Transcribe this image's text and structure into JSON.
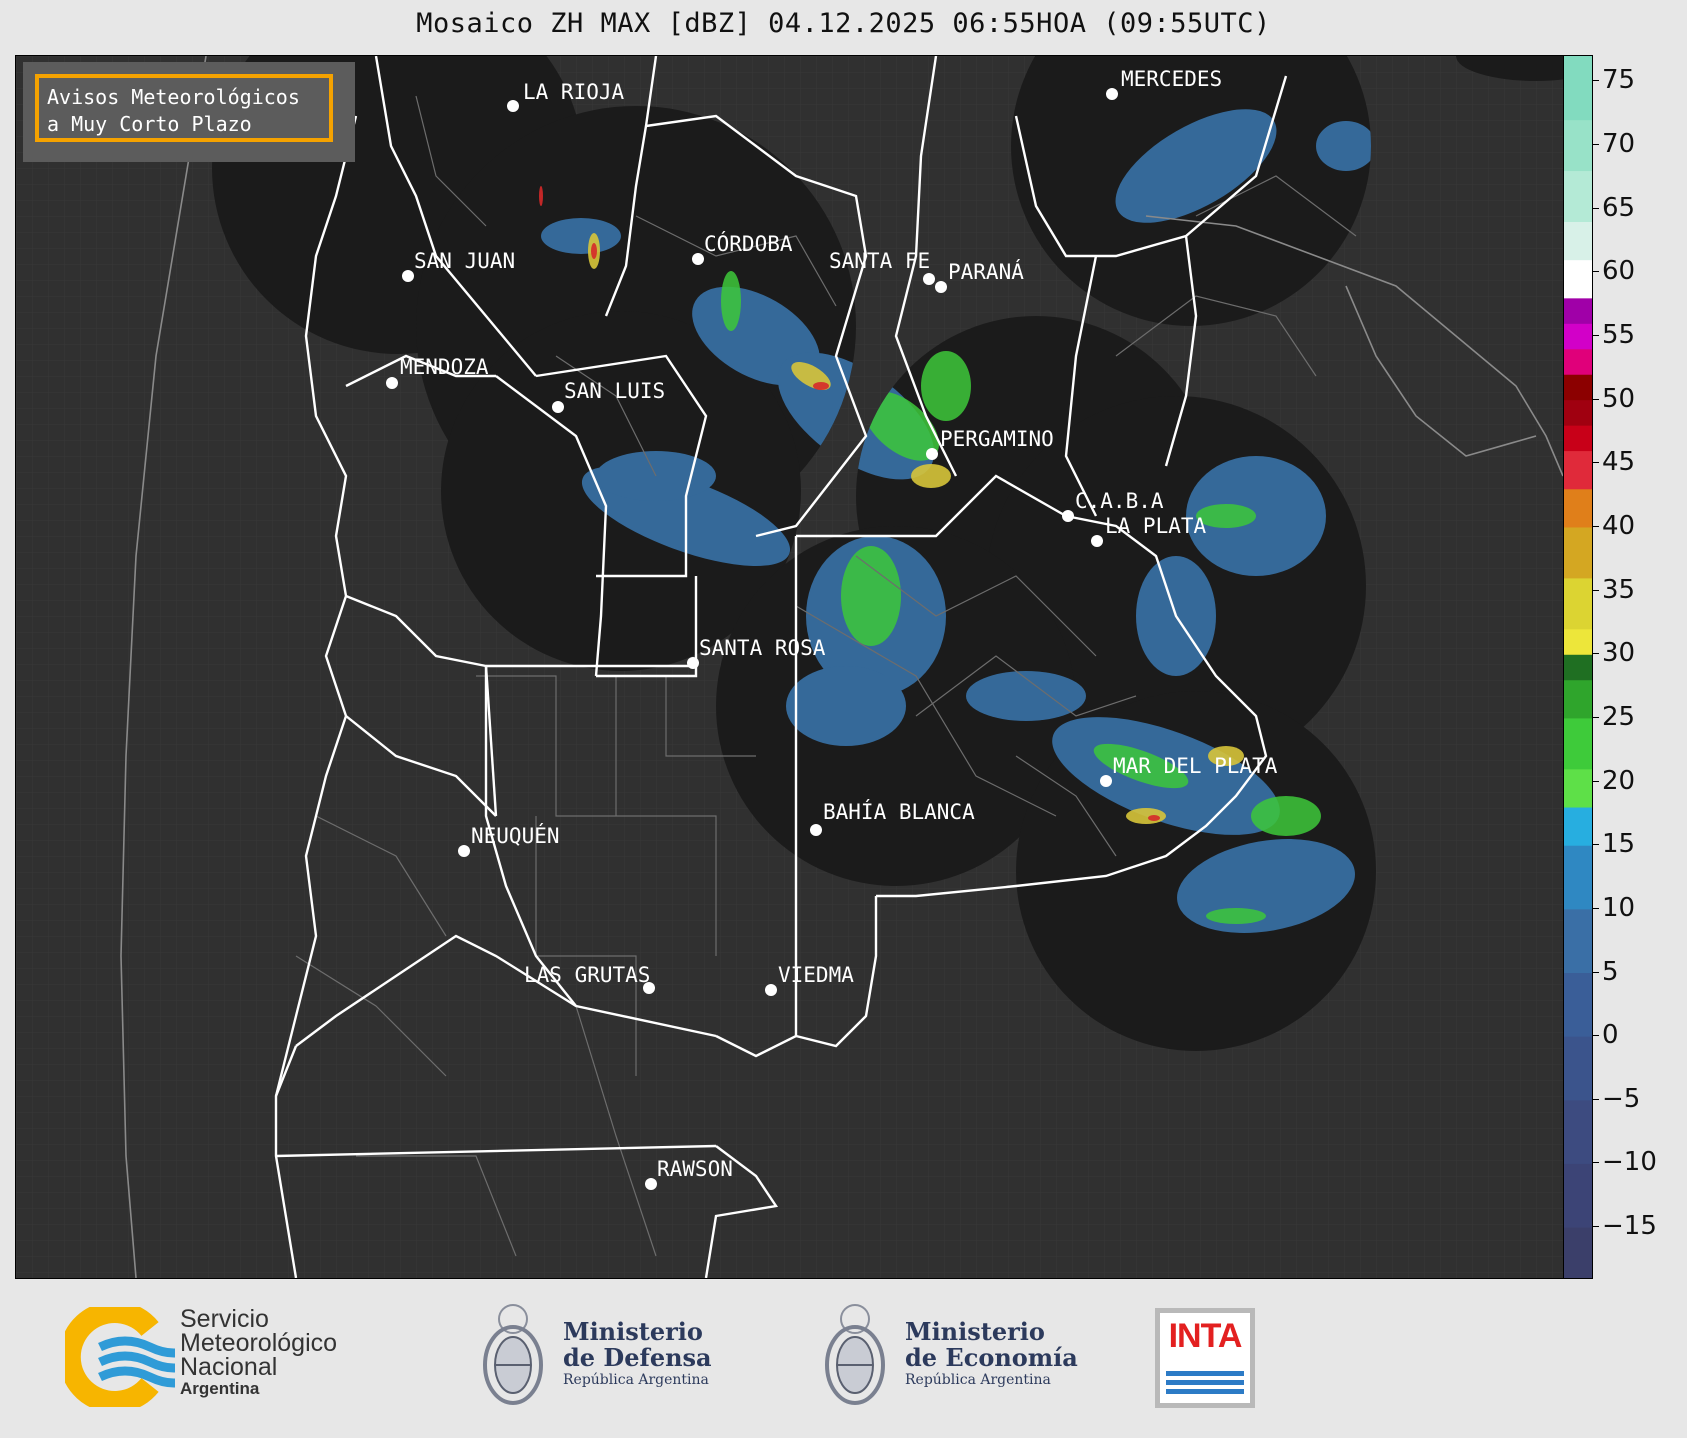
{
  "title": "Mosaico ZH MAX [dBZ] 04.12.2025 06:55HOA (09:55UTC)",
  "avisos": {
    "line1": "Avisos Meteorológicos",
    "line2": "a Muy Corto Plazo"
  },
  "cities": [
    {
      "name": "LA RIOJA",
      "key": "la-rioja"
    },
    {
      "name": "MERCEDES",
      "key": "mercedes"
    },
    {
      "name": "CÓRDOBA",
      "key": "cordoba"
    },
    {
      "name": "SAN JUAN",
      "key": "san-juan"
    },
    {
      "name": "SANTA FE",
      "key": "santa-fe"
    },
    {
      "name": "PARANÁ",
      "key": "parana"
    },
    {
      "name": "MENDOZA",
      "key": "mendoza"
    },
    {
      "name": "SAN LUIS",
      "key": "san-luis"
    },
    {
      "name": "PERGAMINO",
      "key": "pergamino"
    },
    {
      "name": "C.A.B.A",
      "key": "caba"
    },
    {
      "name": "LA PLATA",
      "key": "la-plata"
    },
    {
      "name": "SANTA ROSA",
      "key": "santa-rosa"
    },
    {
      "name": "MAR DEL PLATA",
      "key": "mar-del-plata"
    },
    {
      "name": "BAHÍA BLANCA",
      "key": "bahia-blanca"
    },
    {
      "name": "NEUQUÉN",
      "key": "neuquen"
    },
    {
      "name": "LAS GRUTAS",
      "key": "las-grutas"
    },
    {
      "name": "VIEDMA",
      "key": "viedma"
    },
    {
      "name": "RAWSON",
      "key": "rawson"
    }
  ],
  "colorbar": {
    "min": -19,
    "max": 77,
    "ticks": [
      "75",
      "70",
      "65",
      "60",
      "55",
      "50",
      "45",
      "40",
      "35",
      "30",
      "25",
      "20",
      "15",
      "10",
      "5",
      "0",
      "−5",
      "−10",
      "−15"
    ],
    "tick_values": [
      75,
      70,
      65,
      60,
      55,
      50,
      45,
      40,
      35,
      30,
      25,
      20,
      15,
      10,
      5,
      0,
      -5,
      -10,
      -15
    ],
    "bands": [
      {
        "from": -19,
        "to": -15,
        "color": "#3b3f6a"
      },
      {
        "from": -15,
        "to": -10,
        "color": "#3c4476"
      },
      {
        "from": -10,
        "to": -5,
        "color": "#3d4b80"
      },
      {
        "from": -5,
        "to": 0,
        "color": "#3b548c"
      },
      {
        "from": 0,
        "to": 5,
        "color": "#3a5e98"
      },
      {
        "from": 5,
        "to": 10,
        "color": "#3a6fa6"
      },
      {
        "from": 10,
        "to": 15,
        "color": "#2f88c2"
      },
      {
        "from": 15,
        "to": 18,
        "color": "#27aee0"
      },
      {
        "from": 18,
        "to": 21,
        "color": "#5ee048"
      },
      {
        "from": 21,
        "to": 25,
        "color": "#3ecb3a"
      },
      {
        "from": 25,
        "to": 28,
        "color": "#2fa52c"
      },
      {
        "from": 28,
        "to": 30,
        "color": "#1f6f22"
      },
      {
        "from": 30,
        "to": 32,
        "color": "#ede63a"
      },
      {
        "from": 32,
        "to": 36,
        "color": "#dcd432"
      },
      {
        "from": 36,
        "to": 40,
        "color": "#d4a722"
      },
      {
        "from": 40,
        "to": 43,
        "color": "#e07f1a"
      },
      {
        "from": 43,
        "to": 46,
        "color": "#e02a3a"
      },
      {
        "from": 46,
        "to": 48,
        "color": "#c80018"
      },
      {
        "from": 48,
        "to": 50,
        "color": "#a00010"
      },
      {
        "from": 50,
        "to": 52,
        "color": "#8c0000"
      },
      {
        "from": 52,
        "to": 54,
        "color": "#e0007a"
      },
      {
        "from": 54,
        "to": 56,
        "color": "#d200c8"
      },
      {
        "from": 56,
        "to": 58,
        "color": "#a000a8"
      },
      {
        "from": 58,
        "to": 61,
        "color": "#ffffff"
      },
      {
        "from": 61,
        "to": 64,
        "color": "#d8f1e8"
      },
      {
        "from": 64,
        "to": 68,
        "color": "#b4ead6"
      },
      {
        "from": 68,
        "to": 72,
        "color": "#98e2c8"
      },
      {
        "from": 72,
        "to": 77,
        "color": "#82dbbf"
      }
    ]
  },
  "logos": {
    "smn": {
      "line1": "Servicio",
      "line2": "Meteorológico",
      "line3": "Nacional",
      "line4": "Argentina"
    },
    "defensa": {
      "line1": "Ministerio",
      "line2": "de Defensa",
      "line3": "República Argentina"
    },
    "economia": {
      "line1": "Ministerio",
      "line2": "de Economía",
      "line3": "República Argentina"
    },
    "inta": {
      "text": "INTA"
    }
  }
}
